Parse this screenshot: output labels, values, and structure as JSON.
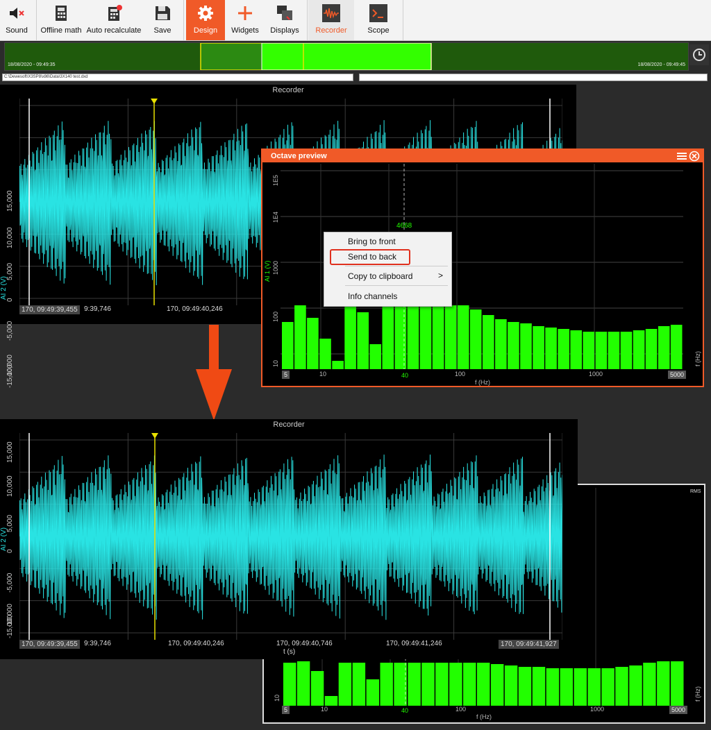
{
  "toolbar": {
    "items": [
      {
        "label": "Sound",
        "icon": "speaker-mute-icon"
      },
      {
        "label": "Offline math",
        "icon": "calculator-icon"
      },
      {
        "label": "Auto recalculate",
        "icon": "calculator-refresh-icon"
      },
      {
        "label": "Save",
        "icon": "floppy-disk-icon"
      },
      {
        "label": "Design",
        "icon": "gear-icon"
      },
      {
        "label": "Widgets",
        "icon": "plus-icon"
      },
      {
        "label": "Displays",
        "icon": "displays-icon"
      },
      {
        "label": "Recorder",
        "icon": "waveform-icon"
      },
      {
        "label": "Scope",
        "icon": "terminal-icon"
      }
    ],
    "accent": "#f05a28"
  },
  "timeline": {
    "start": "18/08/2020 - 09:49:35",
    "end": "18/08/2020 - 09:49:45",
    "icon": "clock-icon"
  },
  "file_path": "C:\\Dewesoft\\X3SP8\\x86\\Data\\3X140 test.dxd",
  "recorder_top": {
    "title": "Recorder",
    "yticks": [
      "15,000",
      "10,000",
      "5,000",
      "0",
      "-5,000",
      "-10,000",
      "-15,000"
    ],
    "ylabel": "AI 2 (V)",
    "time_start": "170, 09:49:39,455",
    "time_labels": [
      "9:39,746",
      "170, 09:49:40,246"
    ]
  },
  "octave": {
    "title": "Octave preview",
    "yticks": [
      "1E5",
      "1E4",
      "1000",
      "100",
      "10"
    ],
    "ylabel": "AI 1 (V)",
    "cursor_value": "4668",
    "xticks": [
      "5",
      "10",
      "40",
      "100",
      "1000",
      "5000"
    ],
    "xlabel": "f (Hz)",
    "yaxis_right": "f (Hz)"
  },
  "context_menu": {
    "items": [
      "Bring to front",
      "Send to back",
      "Copy to clipboard",
      "Info channels"
    ],
    "submenu_arrow": ">"
  },
  "recorder_bottom": {
    "title": "Recorder",
    "yticks": [
      "15,000",
      "10,000",
      "5,000",
      "0",
      "-5,000",
      "-10,000",
      "-15,000"
    ],
    "ylabel": "AI 2 (V)",
    "time_start": "170, 09:49:39,455",
    "time_labels": [
      "9:39,746",
      "170, 09:49:40,246",
      "170, 09:49:40,746",
      "170, 09:49:41,246"
    ],
    "time_end": "170, 09:49:41,927",
    "tlabel": "t (s)"
  },
  "octave_back": {
    "corner_label": "RMS",
    "yticks": [
      "10"
    ],
    "xticks": [
      "5",
      "10",
      "40",
      "100",
      "1000",
      "5000"
    ],
    "xlabel": "f (Hz)",
    "yaxis_right": "f (Hz)"
  },
  "colors": {
    "signal": "#29e3e3",
    "bars": "#22ff00",
    "cursor": "#e8e000",
    "border": "#f05a28"
  }
}
